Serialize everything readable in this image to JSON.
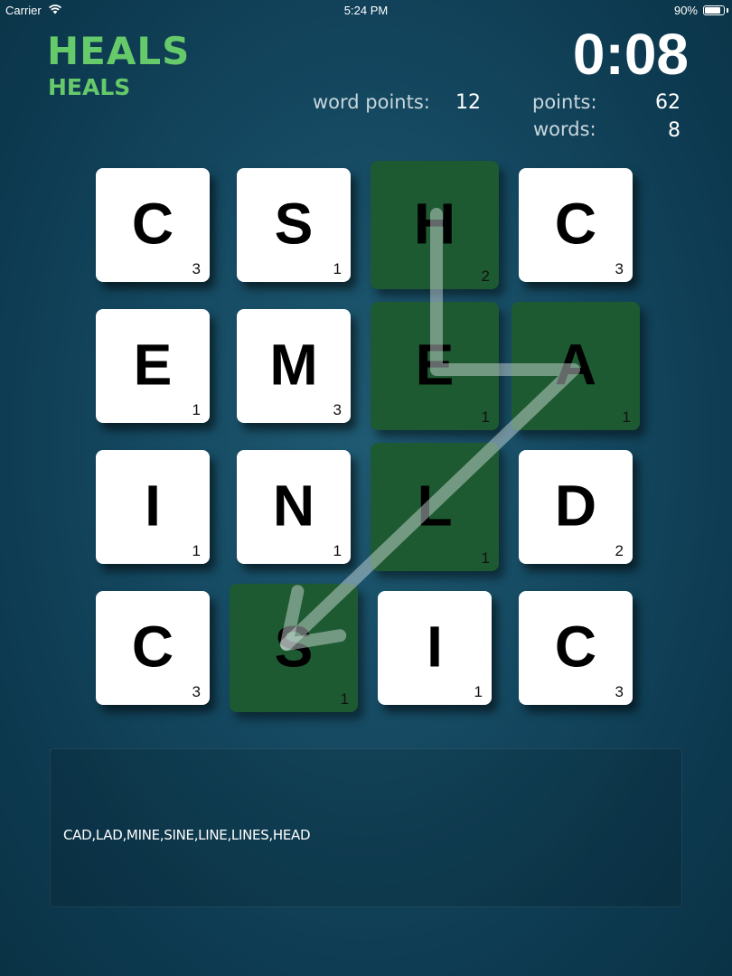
{
  "status_bar": {
    "carrier": "Carrier",
    "time": "5:24 PM",
    "battery_percent": "90%",
    "battery_level": 0.9
  },
  "header": {
    "current_word": "HEALS",
    "current_word_sub": "HEALS",
    "timer": "0:08",
    "word_points_label": "word points:",
    "word_points_value": "12",
    "points_label": "points:",
    "points_value": "62",
    "words_label": "words:",
    "words_value": "8"
  },
  "board": {
    "selected_color": "#1e5a31",
    "tile_color": "#ffffff",
    "tiles": [
      {
        "letter": "C",
        "score": "3",
        "selected": false
      },
      {
        "letter": "S",
        "score": "1",
        "selected": false
      },
      {
        "letter": "H",
        "score": "2",
        "selected": true
      },
      {
        "letter": "C",
        "score": "3",
        "selected": false
      },
      {
        "letter": "E",
        "score": "1",
        "selected": false
      },
      {
        "letter": "M",
        "score": "3",
        "selected": false
      },
      {
        "letter": "E",
        "score": "1",
        "selected": true
      },
      {
        "letter": "A",
        "score": "1",
        "selected": true
      },
      {
        "letter": "I",
        "score": "1",
        "selected": false
      },
      {
        "letter": "N",
        "score": "1",
        "selected": false
      },
      {
        "letter": "L",
        "score": "1",
        "selected": true
      },
      {
        "letter": "D",
        "score": "2",
        "selected": false
      },
      {
        "letter": "C",
        "score": "3",
        "selected": false
      },
      {
        "letter": "S",
        "score": "1",
        "selected": true
      },
      {
        "letter": "I",
        "score": "1",
        "selected": false
      },
      {
        "letter": "C",
        "score": "3",
        "selected": false
      }
    ],
    "selection_path": [
      2,
      6,
      7,
      13
    ]
  },
  "found_words": {
    "text": "CAD,LAD,MINE,SINE,LINE,LINES,HEAD"
  }
}
